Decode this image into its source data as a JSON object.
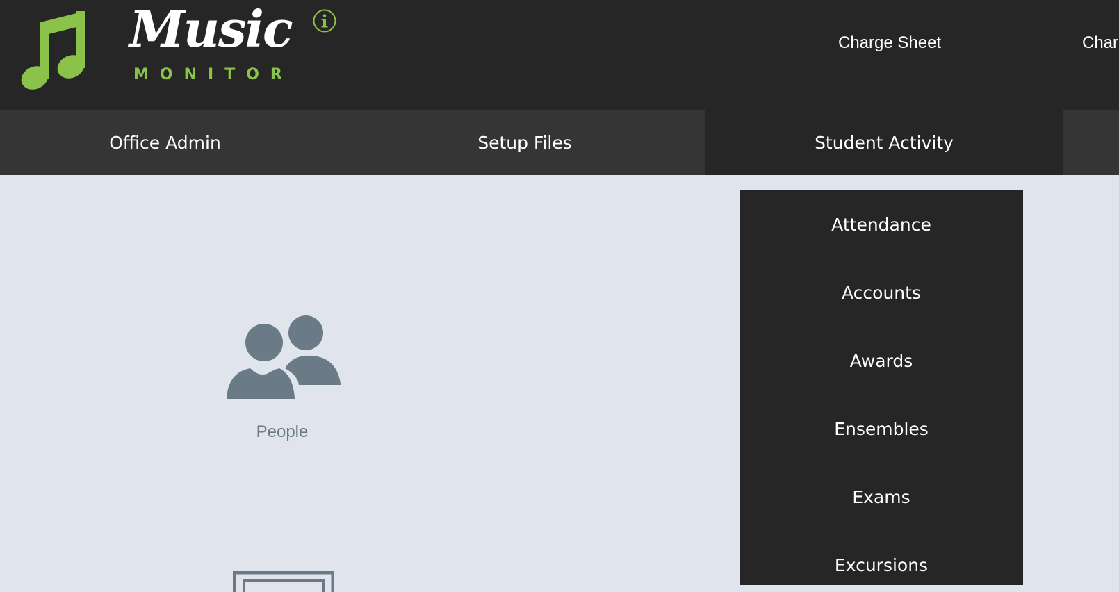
{
  "header": {
    "logo_word": "Music",
    "logo_sub": "MONITOR",
    "links": [
      "Charge Sheet",
      "Char"
    ]
  },
  "nav": {
    "tabs": [
      "Office Admin",
      "Setup Files",
      "Student Activity",
      ""
    ],
    "active_tab": "Student Activity"
  },
  "main": {
    "tiles": [
      {
        "label": "People",
        "icon": "people-icon"
      }
    ]
  },
  "dropdown": {
    "items": [
      "Attendance",
      "Accounts",
      "Awards",
      "Ensembles",
      "Exams",
      "Excursions"
    ]
  },
  "colors": {
    "header_bg": "#262626",
    "nav_bg": "#353535",
    "active_tab_bg": "#262626",
    "content_bg": "#e0e5ed",
    "accent_green": "#8bc34a",
    "icon_gray": "#6b7a87"
  }
}
